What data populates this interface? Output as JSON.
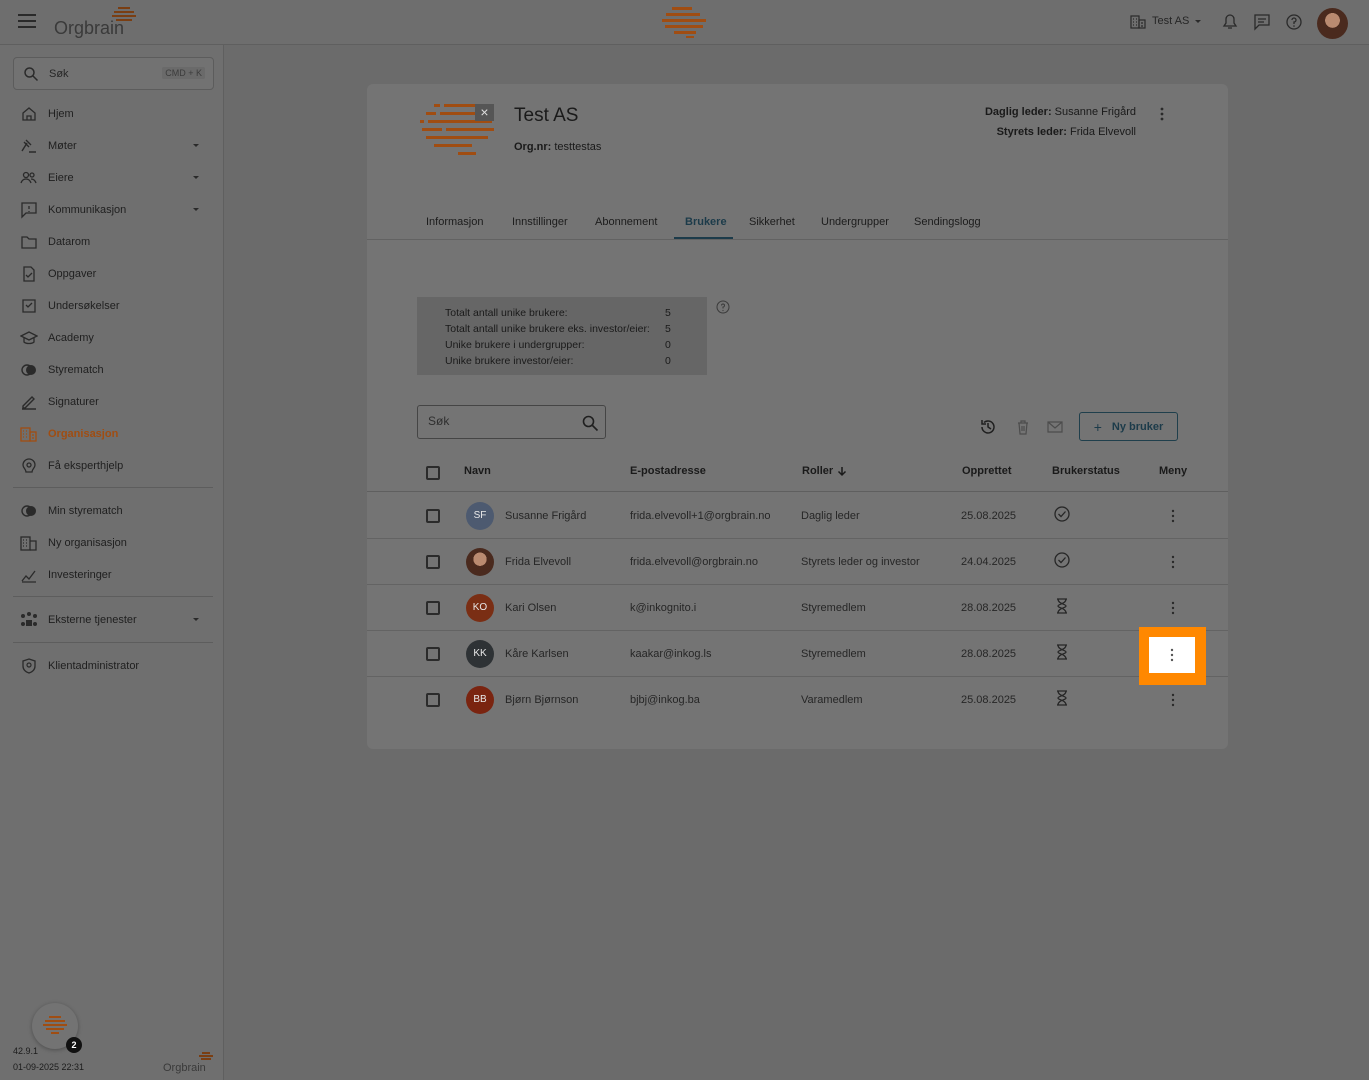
{
  "topbar": {
    "brand": "Orgbrain",
    "org_switch_label": "Test AS",
    "colors": {
      "brand_orange": "#b25a1b",
      "accent": "#1c3b4a",
      "highlight": "#ff8800"
    }
  },
  "sidebar": {
    "search_placeholder": "Søk",
    "search_shortcut": "CMD + K",
    "items": [
      {
        "label": "Hjem",
        "icon": "home-icon"
      },
      {
        "label": "Møter",
        "icon": "gavel-icon"
      },
      {
        "label": "Eiere",
        "icon": "people-icon"
      },
      {
        "label": "Kommunikasjon",
        "icon": "message-icon"
      },
      {
        "label": "Datarom",
        "icon": "folder-icon"
      },
      {
        "label": "Oppgaver",
        "icon": "task-icon"
      },
      {
        "label": "Undersøkelser",
        "icon": "survey-icon"
      },
      {
        "label": "Academy",
        "icon": "graduation-cap-icon"
      },
      {
        "label": "Styrematch",
        "icon": "match-icon"
      },
      {
        "label": "Signaturer",
        "icon": "pen-icon"
      },
      {
        "label": "Organisasjon",
        "icon": "building-icon"
      },
      {
        "label": "Få eksperthjelp",
        "icon": "expert-icon"
      }
    ],
    "items2": [
      {
        "label": "Min styrematch",
        "icon": "match-icon"
      },
      {
        "label": "Ny organisasjon",
        "icon": "building-add-icon"
      },
      {
        "label": "Investeringer",
        "icon": "chart-icon"
      }
    ],
    "external": {
      "label": "Eksterne tjenester",
      "icon": "services-icon"
    },
    "client_admin": {
      "label": "Klientadministrator",
      "icon": "shield-icon"
    },
    "fab_badge": "2",
    "version": "42.9.1",
    "datetime": "01-09-2025 22:31",
    "footer_brand": "Orgbrain"
  },
  "org": {
    "name": "Test AS",
    "orgnr_label": "Org.nr:",
    "orgnr_value": "testtestas",
    "ceo_label": "Daglig leder:",
    "ceo_value": "Susanne Frigård",
    "chair_label": "Styrets leder:",
    "chair_value": "Frida Elvevoll"
  },
  "tabs": [
    "Informasjon",
    "Innstillinger",
    "Abonnement",
    "Brukere",
    "Sikkerhet",
    "Undergrupper",
    "Sendingslogg"
  ],
  "stats": [
    {
      "label": "Totalt antall unike brukere:",
      "value": "5"
    },
    {
      "label": "Totalt antall unike brukere eks. investor/eier:",
      "value": "5"
    },
    {
      "label": "Unike brukere i undergrupper:",
      "value": "0"
    },
    {
      "label": "Unike brukere investor/eier:",
      "value": "0"
    }
  ],
  "table": {
    "search_placeholder": "Søk",
    "new_user_label": "Ny bruker",
    "columns": [
      "Navn",
      "E-postadresse",
      "Roller",
      "Opprettet",
      "Brukerstatus",
      "Meny"
    ],
    "rows": [
      {
        "initials": "SF",
        "name": "Susanne Frigård",
        "email": "frida.elvevoll+1@orgbrain.no",
        "role": "Daglig leder",
        "created": "25.08.2025",
        "status": "active",
        "avatar_color": "#4d5a70"
      },
      {
        "initials": "",
        "name": "Frida Elvevoll",
        "email": "frida.elvevoll@orgbrain.no",
        "role": "Styrets leder og investor",
        "created": "24.04.2025",
        "status": "active",
        "avatar_color": "#4a2a1e"
      },
      {
        "initials": "KO",
        "name": "Kari Olsen",
        "email": "k@inkognito.i",
        "role": "Styremedlem",
        "created": "28.08.2025",
        "status": "pending",
        "avatar_color": "#7a2e14"
      },
      {
        "initials": "KK",
        "name": "Kåre Karlsen",
        "email": "kaakar@inkog.ls",
        "role": "Styremedlem",
        "created": "28.08.2025",
        "status": "pending",
        "avatar_color": "#2e3235"
      },
      {
        "initials": "BB",
        "name": "Bjørn Bjørnson",
        "email": "bjbj@inkog.ba",
        "role": "Varamedlem",
        "created": "25.08.2025",
        "status": "pending",
        "avatar_color": "#7a2410"
      }
    ]
  }
}
